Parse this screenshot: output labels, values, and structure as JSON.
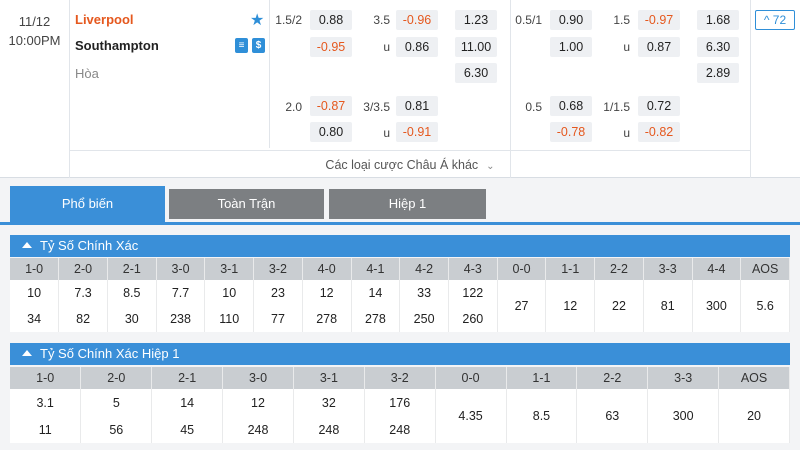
{
  "match": {
    "date": "11/12",
    "time": "10:00PM",
    "home": "Liverpool",
    "away": "Southampton",
    "draw": "Hòa",
    "more_label": "Các loại cược Châu Á khác",
    "market_count": "72"
  },
  "ft_hdp": {
    "line1": "1.5/2",
    "home1": "0.88",
    "away1": "-0.95",
    "line2": "2.0",
    "home2": "-0.87",
    "away2": "0.80"
  },
  "ft_ou": {
    "line1": "3.5",
    "over1": "-0.96",
    "u1": "u",
    "under1": "0.86",
    "line2": "3/3.5",
    "over2": "0.81",
    "u2": "u",
    "under2": "-0.91"
  },
  "ft_1x2": {
    "home": "1.23",
    "away": "11.00",
    "draw": "6.30"
  },
  "h1_hdp": {
    "line1": "0.5/1",
    "home1": "0.90",
    "away1": "1.00",
    "line2": "0.5",
    "home2": "0.68",
    "away2": "-0.78"
  },
  "h1_ou": {
    "line1": "1.5",
    "over1": "-0.97",
    "u1": "u",
    "under1": "0.87",
    "line2": "1/1.5",
    "over2": "0.72",
    "u2": "u",
    "under2": "-0.82"
  },
  "h1_1x2": {
    "home": "1.68",
    "away": "6.30",
    "draw": "2.89"
  },
  "tabs": [
    "Phổ biến",
    "Toàn Trận",
    "Hiệp 1"
  ],
  "sections": {
    "correct_score": "Tỷ Số Chính Xác",
    "correct_score_h1": "Tỷ Số Chính Xác Hiệp 1"
  },
  "cs_headers": [
    "1-0",
    "2-0",
    "2-1",
    "3-0",
    "3-1",
    "3-2",
    "4-0",
    "4-1",
    "4-2",
    "4-3",
    "0-0",
    "1-1",
    "2-2",
    "3-3",
    "4-4",
    "AOS"
  ],
  "cs_home": [
    "10",
    "7.3",
    "8.5",
    "7.7",
    "10",
    "23",
    "12",
    "14",
    "33",
    "122"
  ],
  "cs_away": [
    "34",
    "82",
    "30",
    "238",
    "110",
    "77",
    "278",
    "278",
    "250",
    "260"
  ],
  "cs_single": [
    "27",
    "12",
    "22",
    "81",
    "300",
    "5.6"
  ],
  "cs1_headers": [
    "1-0",
    "2-0",
    "2-1",
    "3-0",
    "3-1",
    "3-2",
    "0-0",
    "1-1",
    "2-2",
    "3-3",
    "AOS"
  ],
  "cs1_home": [
    "3.1",
    "5",
    "14",
    "12",
    "32",
    "176"
  ],
  "cs1_away": [
    "11",
    "56",
    "45",
    "248",
    "248",
    "248"
  ],
  "cs1_single": [
    "4.35",
    "8.5",
    "63",
    "300",
    "20"
  ],
  "colors": {
    "accent": "#3a8fd8",
    "negative": "#e5581e",
    "tab_inactive": "#7c7f82"
  },
  "icons": {
    "favorite": "star-icon",
    "stats": "stats-icon",
    "money": "dollar-icon",
    "expand": "chevron-down-icon"
  }
}
